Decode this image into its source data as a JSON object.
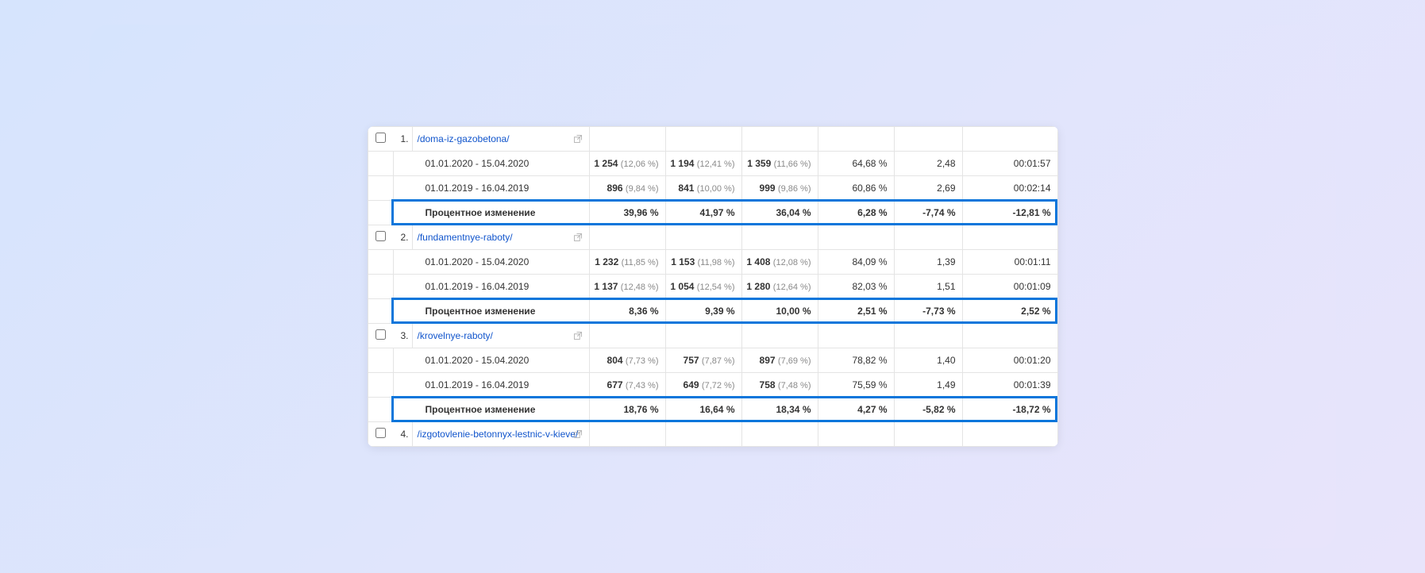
{
  "labels": {
    "change": "Процентное изменение"
  },
  "periods": {
    "current": "01.01.2020 - 15.04.2020",
    "previous": "01.01.2019 - 16.04.2019"
  },
  "groups": [
    {
      "index": "1.",
      "page": "/doma-iz-gazobetona/",
      "current": {
        "v1": "1 254",
        "p1": "(12,06 %)",
        "v2": "1 194",
        "p2": "(12,41 %)",
        "v3": "1 359",
        "p3": "(11,66 %)",
        "v4": "64,68 %",
        "v5": "2,48",
        "v6": "00:01:57"
      },
      "previous": {
        "v1": "896",
        "p1": "(9,84 %)",
        "v2": "841",
        "p2": "(10,00 %)",
        "v3": "999",
        "p3": "(9,86 %)",
        "v4": "60,86 %",
        "v5": "2,69",
        "v6": "00:02:14"
      },
      "change": {
        "v1": "39,96 %",
        "v2": "41,97 %",
        "v3": "36,04 %",
        "v4": "6,28 %",
        "v5": "-7,74 %",
        "v6": "-12,81 %"
      }
    },
    {
      "index": "2.",
      "page": "/fundamentnye-raboty/",
      "current": {
        "v1": "1 232",
        "p1": "(11,85 %)",
        "v2": "1 153",
        "p2": "(11,98 %)",
        "v3": "1 408",
        "p3": "(12,08 %)",
        "v4": "84,09 %",
        "v5": "1,39",
        "v6": "00:01:11"
      },
      "previous": {
        "v1": "1 137",
        "p1": "(12,48 %)",
        "v2": "1 054",
        "p2": "(12,54 %)",
        "v3": "1 280",
        "p3": "(12,64 %)",
        "v4": "82,03 %",
        "v5": "1,51",
        "v6": "00:01:09"
      },
      "change": {
        "v1": "8,36 %",
        "v2": "9,39 %",
        "v3": "10,00 %",
        "v4": "2,51 %",
        "v5": "-7,73 %",
        "v6": "2,52 %"
      }
    },
    {
      "index": "3.",
      "page": "/krovelnye-raboty/",
      "current": {
        "v1": "804",
        "p1": "(7,73 %)",
        "v2": "757",
        "p2": "(7,87 %)",
        "v3": "897",
        "p3": "(7,69 %)",
        "v4": "78,82 %",
        "v5": "1,40",
        "v6": "00:01:20"
      },
      "previous": {
        "v1": "677",
        "p1": "(7,43 %)",
        "v2": "649",
        "p2": "(7,72 %)",
        "v3": "758",
        "p3": "(7,48 %)",
        "v4": "75,59 %",
        "v5": "1,49",
        "v6": "00:01:39"
      },
      "change": {
        "v1": "18,76 %",
        "v2": "16,64 %",
        "v3": "18,34 %",
        "v4": "4,27 %",
        "v5": "-5,82 %",
        "v6": "-18,72 %"
      }
    },
    {
      "index": "4.",
      "page": "/izgotovlenie-betonnyx-lestnic-v-kieve/"
    }
  ]
}
